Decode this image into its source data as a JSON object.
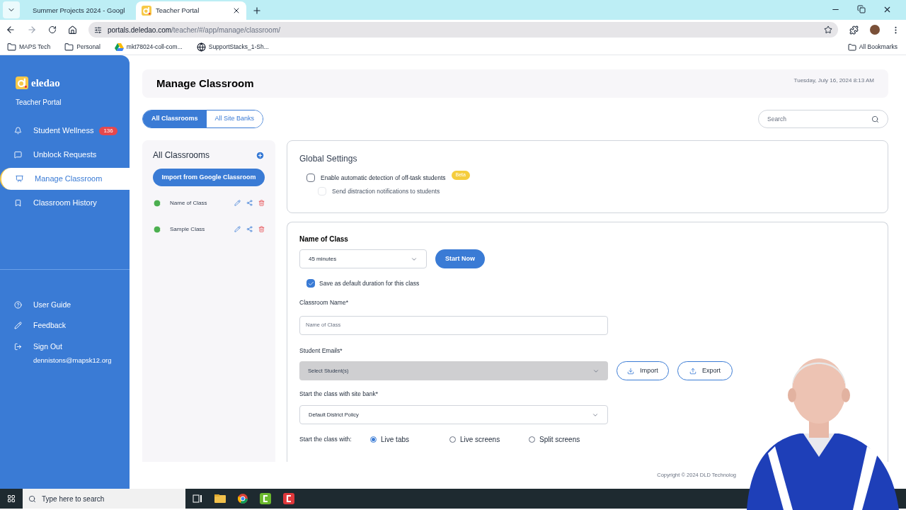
{
  "browser": {
    "tabs": [
      {
        "title": "Summer Projects 2024 - Googl",
        "selected": false,
        "kind": "sheet"
      },
      {
        "title": "Teacher Portal",
        "selected": true,
        "kind": "portal"
      }
    ],
    "address_host": "portals.deledao.com",
    "address_path": "/teacher/#/app/manage/classroom/",
    "bookmarks": [
      {
        "label": "MAPS Tech",
        "kind": "folder"
      },
      {
        "label": "Personal",
        "kind": "folder"
      },
      {
        "label": "mkt78024-coll-com...",
        "kind": "drive"
      },
      {
        "label": "SupportStacks_1-Sh...",
        "kind": "globe"
      }
    ],
    "all_bookmarks": "All Bookmarks"
  },
  "sidebar": {
    "brand": "eledao",
    "subtitle": "Teacher Portal",
    "nav": [
      {
        "label": "Student Wellness",
        "badge": "136",
        "selected": false,
        "kind": "bell"
      },
      {
        "label": "Unblock Requests",
        "selected": false,
        "kind": "chat"
      },
      {
        "label": "Manage Classroom",
        "selected": true,
        "kind": "board"
      },
      {
        "label": "Classroom History",
        "selected": false,
        "kind": "bookmark"
      }
    ],
    "footer": [
      {
        "label": "User Guide",
        "kind": "help"
      },
      {
        "label": "Feedback",
        "kind": "pen"
      },
      {
        "label": "Sign Out",
        "sub": "dennistons@mapsk12.org",
        "kind": "signout"
      }
    ]
  },
  "header": {
    "title": "Manage Classroom",
    "date": "Tuesday, July 16, 2024 8:13 AM"
  },
  "view_tabs": [
    {
      "label": "All Classrooms",
      "selected": true
    },
    {
      "label": "All Site Banks",
      "selected": false
    }
  ],
  "search": {
    "placeholder": "Search"
  },
  "classrooms": {
    "title": "All Classrooms",
    "import_button": "Import from Google Classroom",
    "items": [
      {
        "name": "Name of Class"
      },
      {
        "name": "Sample Class"
      }
    ]
  },
  "global_settings": {
    "title": "Global Settings",
    "options": [
      {
        "label": "Enable automatic detection of off-task students",
        "checked": false,
        "disabled": false,
        "badge": "Beta"
      },
      {
        "label": "Send distraction notifications to students",
        "checked": false,
        "disabled": true
      }
    ]
  },
  "class_form": {
    "title": "Name of Class",
    "duration": "45 minutes",
    "start_button": "Start Now",
    "save_default": {
      "label": "Save as default duration for this class",
      "checked": true
    },
    "name_label": "Classroom Name*",
    "name_placeholder": "Name of Class",
    "emails_label": "Student Emails*",
    "emails_placeholder": "Select Student(s)",
    "import_button": "Import",
    "export_button": "Export",
    "bank_label": "Start the class with site bank*",
    "bank_value": "Default District Policy",
    "mode_label": "Start the class with:",
    "modes": [
      {
        "label": "Live tabs",
        "selected": true
      },
      {
        "label": "Live screens",
        "selected": false
      },
      {
        "label": "Split screens",
        "selected": false
      }
    ]
  },
  "copyright": "Copyright © 2024 DLD Technolog",
  "taskbar": {
    "search_placeholder": "Type here to search"
  }
}
